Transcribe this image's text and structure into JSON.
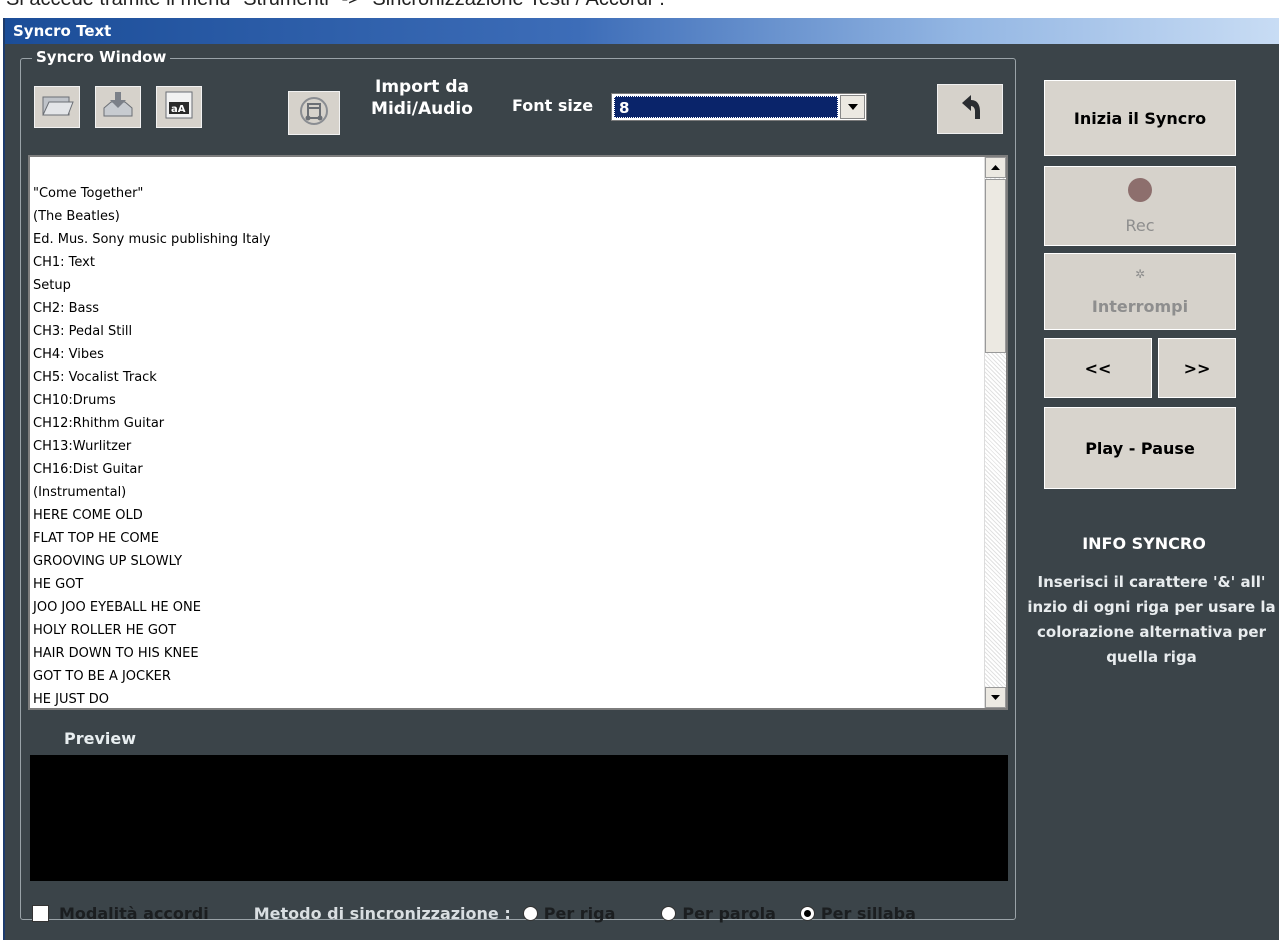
{
  "caption": "Si accede tramite il menu \"Strumenti\" -> \"Sincronizzazione Testi / Accordi\".",
  "window": {
    "title": "Syncro Text"
  },
  "syncro_window": {
    "group_label": "Syncro Window",
    "import_label_line1": "Import da",
    "import_label_line2": "Midi/Audio",
    "font_size_label": "Font size",
    "font_size_value": "8",
    "icons": [
      "open-folder-icon",
      "save-disk-icon",
      "font-aa-icon",
      "import-midi-audio-icon",
      "undo-icon"
    ],
    "text_lines": [
      "\"Come Together\"",
      "(The Beatles)",
      "Ed. Mus. Sony music publishing Italy",
      "CH1: Text",
      "Setup",
      "CH2: Bass",
      "CH3: Pedal Still",
      "CH4: Vibes",
      "CH5: Vocalist Track",
      "CH10:Drums",
      "CH12:Rhithm Guitar",
      "CH13:Wurlitzer",
      "CH16:Dist Guitar",
      "(Instrumental)",
      "HERE COME OLD",
      "FLAT TOP HE COME",
      "GROOVING UP SLOWLY",
      "HE GOT",
      "JOO JOO EYEBALL HE ONE",
      "HOLY ROLLER HE GOT",
      "HAIR DOWN TO HIS KNEE",
      "GOT TO BE  A JOCKER",
      "HE JUST DO"
    ],
    "preview_label": "Preview",
    "chord_mode_label": "Modalità accordi",
    "chord_mode_checked": false,
    "sync_method_label": "Metodo di sincronizzazione :",
    "sync_options": [
      {
        "label": "Per riga",
        "selected": false
      },
      {
        "label": "Per parola",
        "selected": false
      },
      {
        "label": "Per sillaba",
        "selected": true
      }
    ]
  },
  "side": {
    "start_label": "Inizia il Syncro",
    "rec_label": "Rec",
    "stop_label": "Interrompi",
    "prev_label": "<<",
    "next_label": ">>",
    "play_label": "Play - Pause",
    "info_title": "INFO SYNCRO",
    "info_text": "Inserisci il carattere '&' all' inzio di ogni riga per usare la colorazione alternativa per quella riga"
  },
  "colors": {
    "panel_bg": "#3b4449",
    "button_bg": "#d8d4cd",
    "selection_bg": "#0a246a",
    "rec_dot": "#8d6f6d"
  }
}
